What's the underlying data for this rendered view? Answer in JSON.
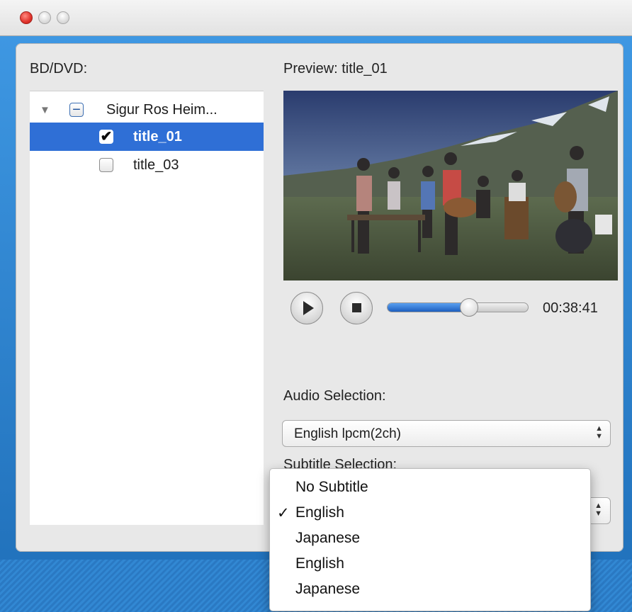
{
  "window": {
    "title_bar_buttons": [
      "close",
      "minimize",
      "maximize"
    ]
  },
  "source": {
    "label": "BD/DVD:",
    "tree": [
      {
        "label": "Sigur Ros Heim...",
        "level": 0,
        "expanded": true,
        "checkbox": "mixed",
        "selected": false
      },
      {
        "label": "title_01",
        "level": 1,
        "checkbox": "checked",
        "selected": true
      },
      {
        "label": "title_03",
        "level": 1,
        "checkbox": "unchecked",
        "selected": false
      }
    ]
  },
  "preview": {
    "label": "Preview: title_01",
    "image": "band-playing-instruments-on-hillside",
    "controls": {
      "play_icon": "play-icon",
      "stop_icon": "stop-icon",
      "progress_fraction": 0.58,
      "time": "00:38:41"
    }
  },
  "audio": {
    "label": "Audio Selection:",
    "selected": "English lpcm(2ch)"
  },
  "subtitle": {
    "label": "Subtitle Selection:",
    "options": [
      {
        "label": "No Subtitle",
        "checked": false
      },
      {
        "label": "English",
        "checked": true
      },
      {
        "label": "Japanese",
        "checked": false
      },
      {
        "label": "English",
        "checked": false
      },
      {
        "label": "Japanese",
        "checked": false
      }
    ],
    "check_glyph": "✓"
  },
  "colors": {
    "selection": "#2f6fd6",
    "frame": "#2f86cf"
  }
}
